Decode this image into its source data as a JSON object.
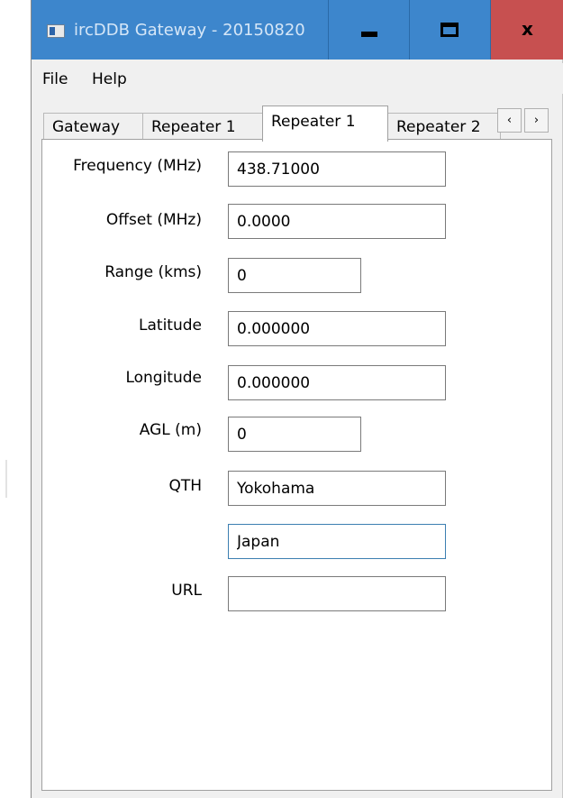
{
  "window": {
    "title": "ircDDB Gateway - 20150820",
    "minimize_glyph": "minimize-icon",
    "maximize_glyph": "maximize-icon",
    "close_label": "x",
    "titlebar_color": "#3d86cc",
    "close_color": "#c75050"
  },
  "menu": {
    "items": [
      {
        "label": "File"
      },
      {
        "label": "Help"
      }
    ]
  },
  "tabs": {
    "items": [
      {
        "label": "Gateway",
        "selected": false
      },
      {
        "label": "Repeater 1",
        "selected": false
      },
      {
        "label": "Repeater 1",
        "selected": true
      },
      {
        "label": "Repeater 2",
        "selected": false
      }
    ],
    "scroll_left": "‹",
    "scroll_right": "›"
  },
  "form": {
    "frequency": {
      "label": "Frequency (MHz)",
      "value": "438.71000"
    },
    "offset": {
      "label": "Offset (MHz)",
      "value": "0.0000"
    },
    "range": {
      "label": "Range (kms)",
      "value": "0"
    },
    "latitude": {
      "label": "Latitude",
      "value": "0.000000"
    },
    "longitude": {
      "label": "Longitude",
      "value": "0.000000"
    },
    "agl": {
      "label": "AGL (m)",
      "value": "0"
    },
    "qth": {
      "label": "QTH",
      "value": "Yokohama"
    },
    "qth2": {
      "value": "Japan"
    },
    "url": {
      "label": "URL",
      "value": ""
    }
  }
}
